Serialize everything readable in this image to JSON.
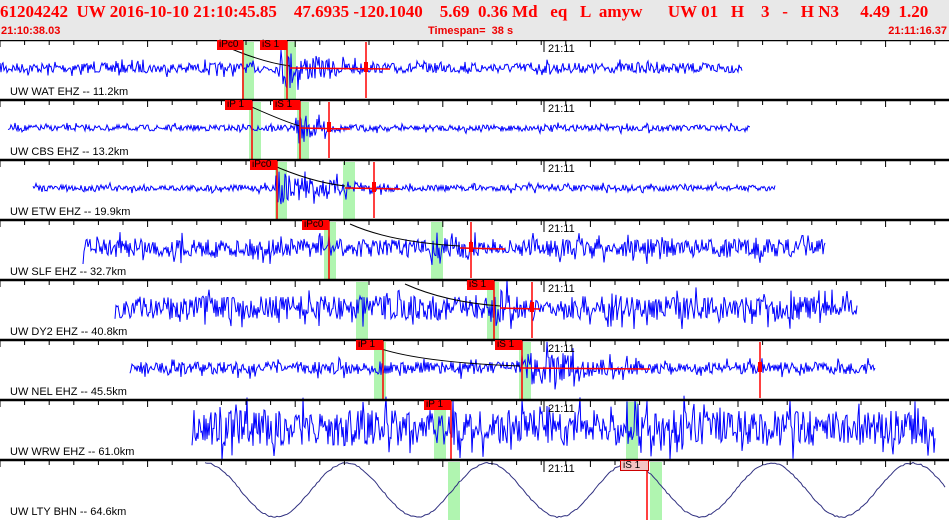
{
  "header": {
    "title": "61204242  UW 2016-10-10 21:10:45.85    47.6935 -120.1040    5.69  0.36 Md   eq   L  amyw      UW 01   H    3   -   H N3     4.49  1.20",
    "start_time": "21:10:38.03",
    "timespan": "Timespan=  38 s",
    "end_time": "21:11:16.37"
  },
  "minute_label": "21:11",
  "channels": [
    {
      "label": "UW WAT EHZ -- 11.2km",
      "picks": [
        "iPc0",
        "iS 1"
      ]
    },
    {
      "label": "UW CBS EHZ -- 13.2km",
      "picks": [
        "iP 1",
        "iS 1"
      ]
    },
    {
      "label": "UW ETW EHZ -- 19.9km",
      "picks": [
        "iPc0"
      ]
    },
    {
      "label": "UW SLF EHZ -- 32.7km",
      "picks": [
        "iPc0"
      ]
    },
    {
      "label": "UW DY2 EHZ -- 40.8km",
      "picks": [
        "iS 1"
      ]
    },
    {
      "label": "UW NEL EHZ -- 45.5km",
      "picks": [
        "iP 1",
        "iS 1"
      ]
    },
    {
      "label": "UW WRW EHZ -- 61.0km",
      "picks": [
        "iP 1"
      ]
    },
    {
      "label": "UW LTY BHN -- 64.6km",
      "picks": [
        "iS 1"
      ]
    }
  ],
  "colors": {
    "trace": "#0000ff",
    "pick": "#ff0000",
    "window": "#b0f5b0",
    "header_text": "#ff0000"
  }
}
